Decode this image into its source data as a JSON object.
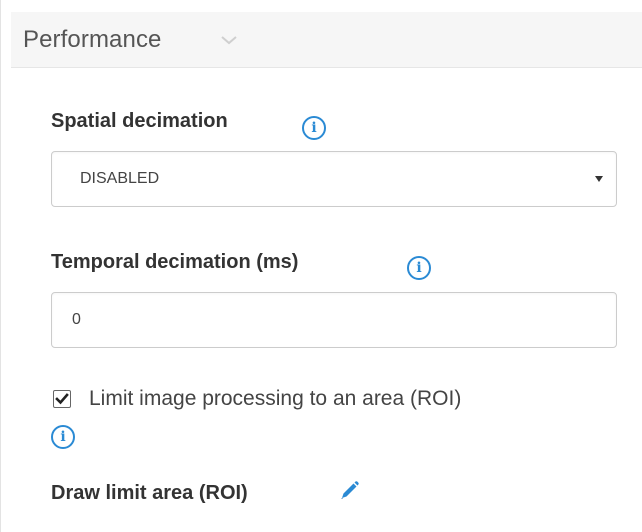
{
  "panel": {
    "title": "Performance"
  },
  "spatial_decimation": {
    "label": "Spatial decimation",
    "selected": "DISABLED",
    "info_glyph": "i"
  },
  "temporal_decimation": {
    "label": "Temporal decimation (ms)",
    "value": "0",
    "info_glyph": "i"
  },
  "roi_limit": {
    "checked": true,
    "label": "Limit image processing to an area (ROI)",
    "info_glyph": "i"
  },
  "draw_roi": {
    "label": "Draw limit area (ROI)"
  },
  "icons": {
    "title_caret": "caret-down-icon",
    "info": "info-icon",
    "select_arrow": "triangle-down-icon",
    "checkmark": "checkmark-icon",
    "edit": "pencil-icon"
  },
  "colors": {
    "accent": "#2a8ad4",
    "header_bg": "#f6f6f6",
    "border": "#cccccc",
    "text": "#333333"
  }
}
